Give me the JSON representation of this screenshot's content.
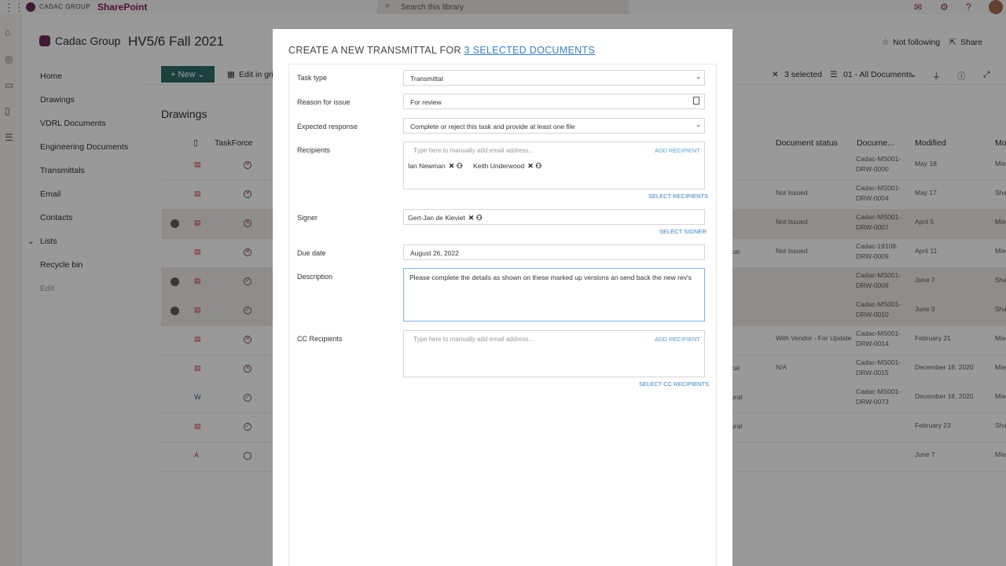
{
  "topbar": {
    "brand": "CADAC GROUP",
    "app": "SharePoint",
    "search_placeholder": "Search this library"
  },
  "site": {
    "name": "Cadac Group",
    "title": "HV5/6 Fall 2021",
    "not_following": "Not following",
    "share": "Share"
  },
  "nav": [
    "Home",
    "Drawings",
    "VDRL Documents",
    "Engineering Documents",
    "Transmittals",
    "Email",
    "Contacts",
    "Lists",
    "Recycle bin",
    "Edit"
  ],
  "commandbar": {
    "new": "New",
    "edit_in_grid": "Edit in grid view",
    "selected": "3 selected",
    "view": "01 - All Documents"
  },
  "library": {
    "title": "Drawings",
    "columns": {
      "taskforce": "TaskForce",
      "document_status": "Document status",
      "document": "Docume...",
      "modified": "Modified",
      "modified_by": "Mo"
    },
    "rows": [
      {
        "type": "pdf",
        "status": "",
        "doc": "Cadac-MS001-DRW-0000",
        "modified": "May 18",
        "by": "Mie",
        "col": "",
        "selected": false,
        "check": "x"
      },
      {
        "type": "pdf",
        "status": "Not Issued",
        "doc": "Cadac-MS001-DRW-0004",
        "modified": "May 17",
        "by": "Sha",
        "col": "",
        "selected": false,
        "check": "x"
      },
      {
        "type": "pdf",
        "status": "Not Issued",
        "doc": "Cadac-MS001-DRW-0007",
        "modified": "April 5",
        "by": "Mie",
        "col": "",
        "selected": true,
        "check": "x"
      },
      {
        "type": "pdf",
        "status": "Not Issued",
        "doc": "Cadac-19108-DRW-0009",
        "modified": "April 11",
        "by": "Mie",
        "col": "cal",
        "selected": false,
        "check": "x"
      },
      {
        "type": "pdf",
        "status": "",
        "doc": "Cadac-MS001-DRW-0009",
        "modified": "June 7",
        "by": "Sha",
        "col": "",
        "selected": true,
        "check": "ok"
      },
      {
        "type": "pdf",
        "status": "",
        "doc": "Cadac-MS001-DRW-0010",
        "modified": "June 3",
        "by": "Sha",
        "col": "",
        "selected": true,
        "check": "ok"
      },
      {
        "type": "pdf",
        "status": "With Vendor - For Update",
        "doc": "Cadac-MS001-DRW-0014",
        "modified": "February 21",
        "by": "Mie",
        "col": "",
        "selected": false,
        "check": "x"
      },
      {
        "type": "pdf",
        "status": "N/A",
        "doc": "Cadac-MS001-DRW-0015",
        "modified": "December 18, 2020",
        "by": "Mie",
        "col": "cal",
        "selected": false,
        "check": "x"
      },
      {
        "type": "word",
        "status": "",
        "doc": "Cadac-MS001-DRW-0073",
        "modified": "December 18, 2020",
        "by": "Mie",
        "col": "ural",
        "selected": false,
        "check": "ok"
      },
      {
        "type": "pdf",
        "status": "",
        "doc": "",
        "modified": "February 23",
        "by": "Sha",
        "col": "ural",
        "selected": false,
        "check": "ok"
      },
      {
        "type": "acrobat",
        "status": "",
        "doc": "",
        "modified": "June 7",
        "by": "Mie",
        "col": "",
        "selected": false,
        "check": "empty"
      }
    ]
  },
  "dialog": {
    "title_prefix": "CREATE A NEW TRANSMITTAL FOR",
    "title_link": "3 SELECTED DOCUMENTS",
    "task_type_label": "Task type",
    "task_type_value": "Transmittal",
    "reason_label": "Reason for issue",
    "reason_value": "For review",
    "expected_label": "Expected response",
    "expected_value": "Complete or reject this task and provide at least one file",
    "recipients_label": "Recipients",
    "recipients_placeholder": "Type here to manually add email address...",
    "add_recipient": "ADD RECIPIENT",
    "recipients": [
      "Ian Newman",
      "Keith Underwood"
    ],
    "select_recipients": "SELECT RECIPIENTS",
    "signer_label": "Signer",
    "signer": "Gert-Jan de Kieviet",
    "select_signer": "SELECT SIGNER",
    "due_label": "Due date",
    "due_value": "August 26, 2022",
    "description_label": "Description",
    "description_value": "Please complete the details as shown on these marked up versions an send back the new rev's",
    "cc_label": "CC Recipients",
    "cc_placeholder": "Type here to manually add email address...",
    "add_cc": "ADD RECIPIENT",
    "select_cc": "SELECT CC RECIPIENTS"
  }
}
